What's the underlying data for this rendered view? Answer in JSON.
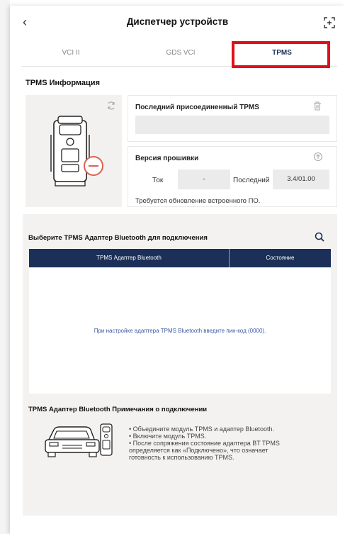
{
  "header": {
    "title": "Диспетчер устройств",
    "back_icon": "chevron-left-icon",
    "expand_icon": "expand-icon"
  },
  "tabs": [
    {
      "label": "VCI II",
      "active": false
    },
    {
      "label": "GDS VCI",
      "active": false
    },
    {
      "label": "TPMS",
      "active": true
    }
  ],
  "highlight_color": "#e0101a",
  "tpms_info": {
    "section_label": "TPMS Информация",
    "last_connected_title": "Последний присоединенный TPMS",
    "last_connected_value": "",
    "firmware": {
      "title": "Версия прошивки",
      "current_label": "Ток",
      "current_value": "-",
      "latest_label": "Последний",
      "latest_value": "3.4/01.00",
      "note": "Требуется обновление встроенного ПО."
    }
  },
  "bluetooth": {
    "title": "Выберите TPMS Адаптер Bluetooth для подключения",
    "columns": [
      "TPMS Адаптер Bluetooth",
      "Состояние"
    ],
    "empty_message": "При настройке адаптера TPMS Bluetooth введите пин-код (0000).",
    "header_color": "#1b2f58"
  },
  "notes": {
    "title": "TPMS Адаптер Bluetooth Примечания о подключении",
    "lines": [
      "• Объедините модуль TPMS и адаптер Bluetooth.",
      "• Включите модуль TPMS.",
      "• После сопряжения состояние адаптера BT TPMS",
      "определяется как «Подключено», что означает",
      "готовность к использованию TPMS."
    ]
  }
}
